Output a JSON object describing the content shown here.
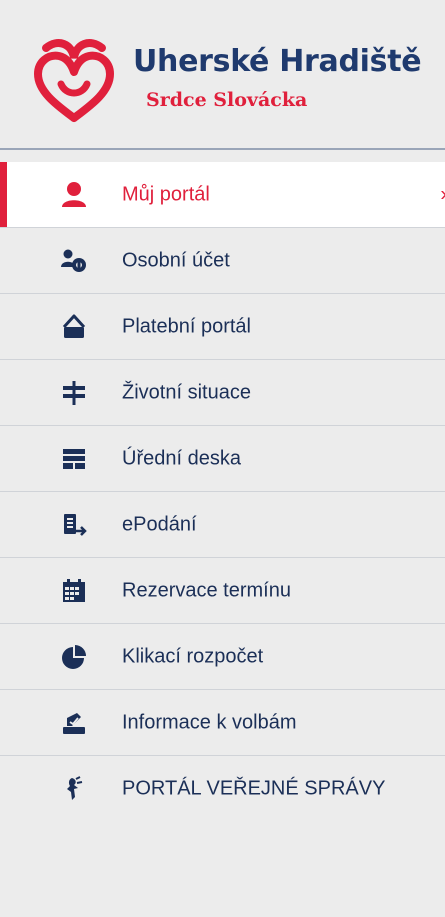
{
  "brand": {
    "title": "Uherské Hradiště",
    "subtitle": "Srdce Slovácka",
    "logo_icon": "heart-logo-icon"
  },
  "colors": {
    "accent": "#e0203c",
    "navy": "#1f3a6e",
    "background": "#ececec",
    "active_background": "#ffffff"
  },
  "menu": {
    "items": [
      {
        "label": "Můj portál",
        "icon": "user-icon",
        "active": true
      },
      {
        "label": "Osobní účet",
        "icon": "account-users-icon"
      },
      {
        "label": "Platební portál",
        "icon": "payment-card-icon"
      },
      {
        "label": "Životní situace",
        "icon": "signpost-icon"
      },
      {
        "label": "Úřední deska",
        "icon": "noticeboard-icon"
      },
      {
        "label": "ePodání",
        "icon": "e-submission-icon"
      },
      {
        "label": "Rezervace termínu",
        "icon": "calendar-icon"
      },
      {
        "label": "Klikací rozpočet",
        "icon": "pie-chart-icon"
      },
      {
        "label": "Informace k volbám",
        "icon": "ballot-icon"
      },
      {
        "label": "PORTÁL VEŘEJNÉ SPRÁVY",
        "icon": "state-emblem-icon"
      }
    ],
    "active_chevron": "›"
  }
}
